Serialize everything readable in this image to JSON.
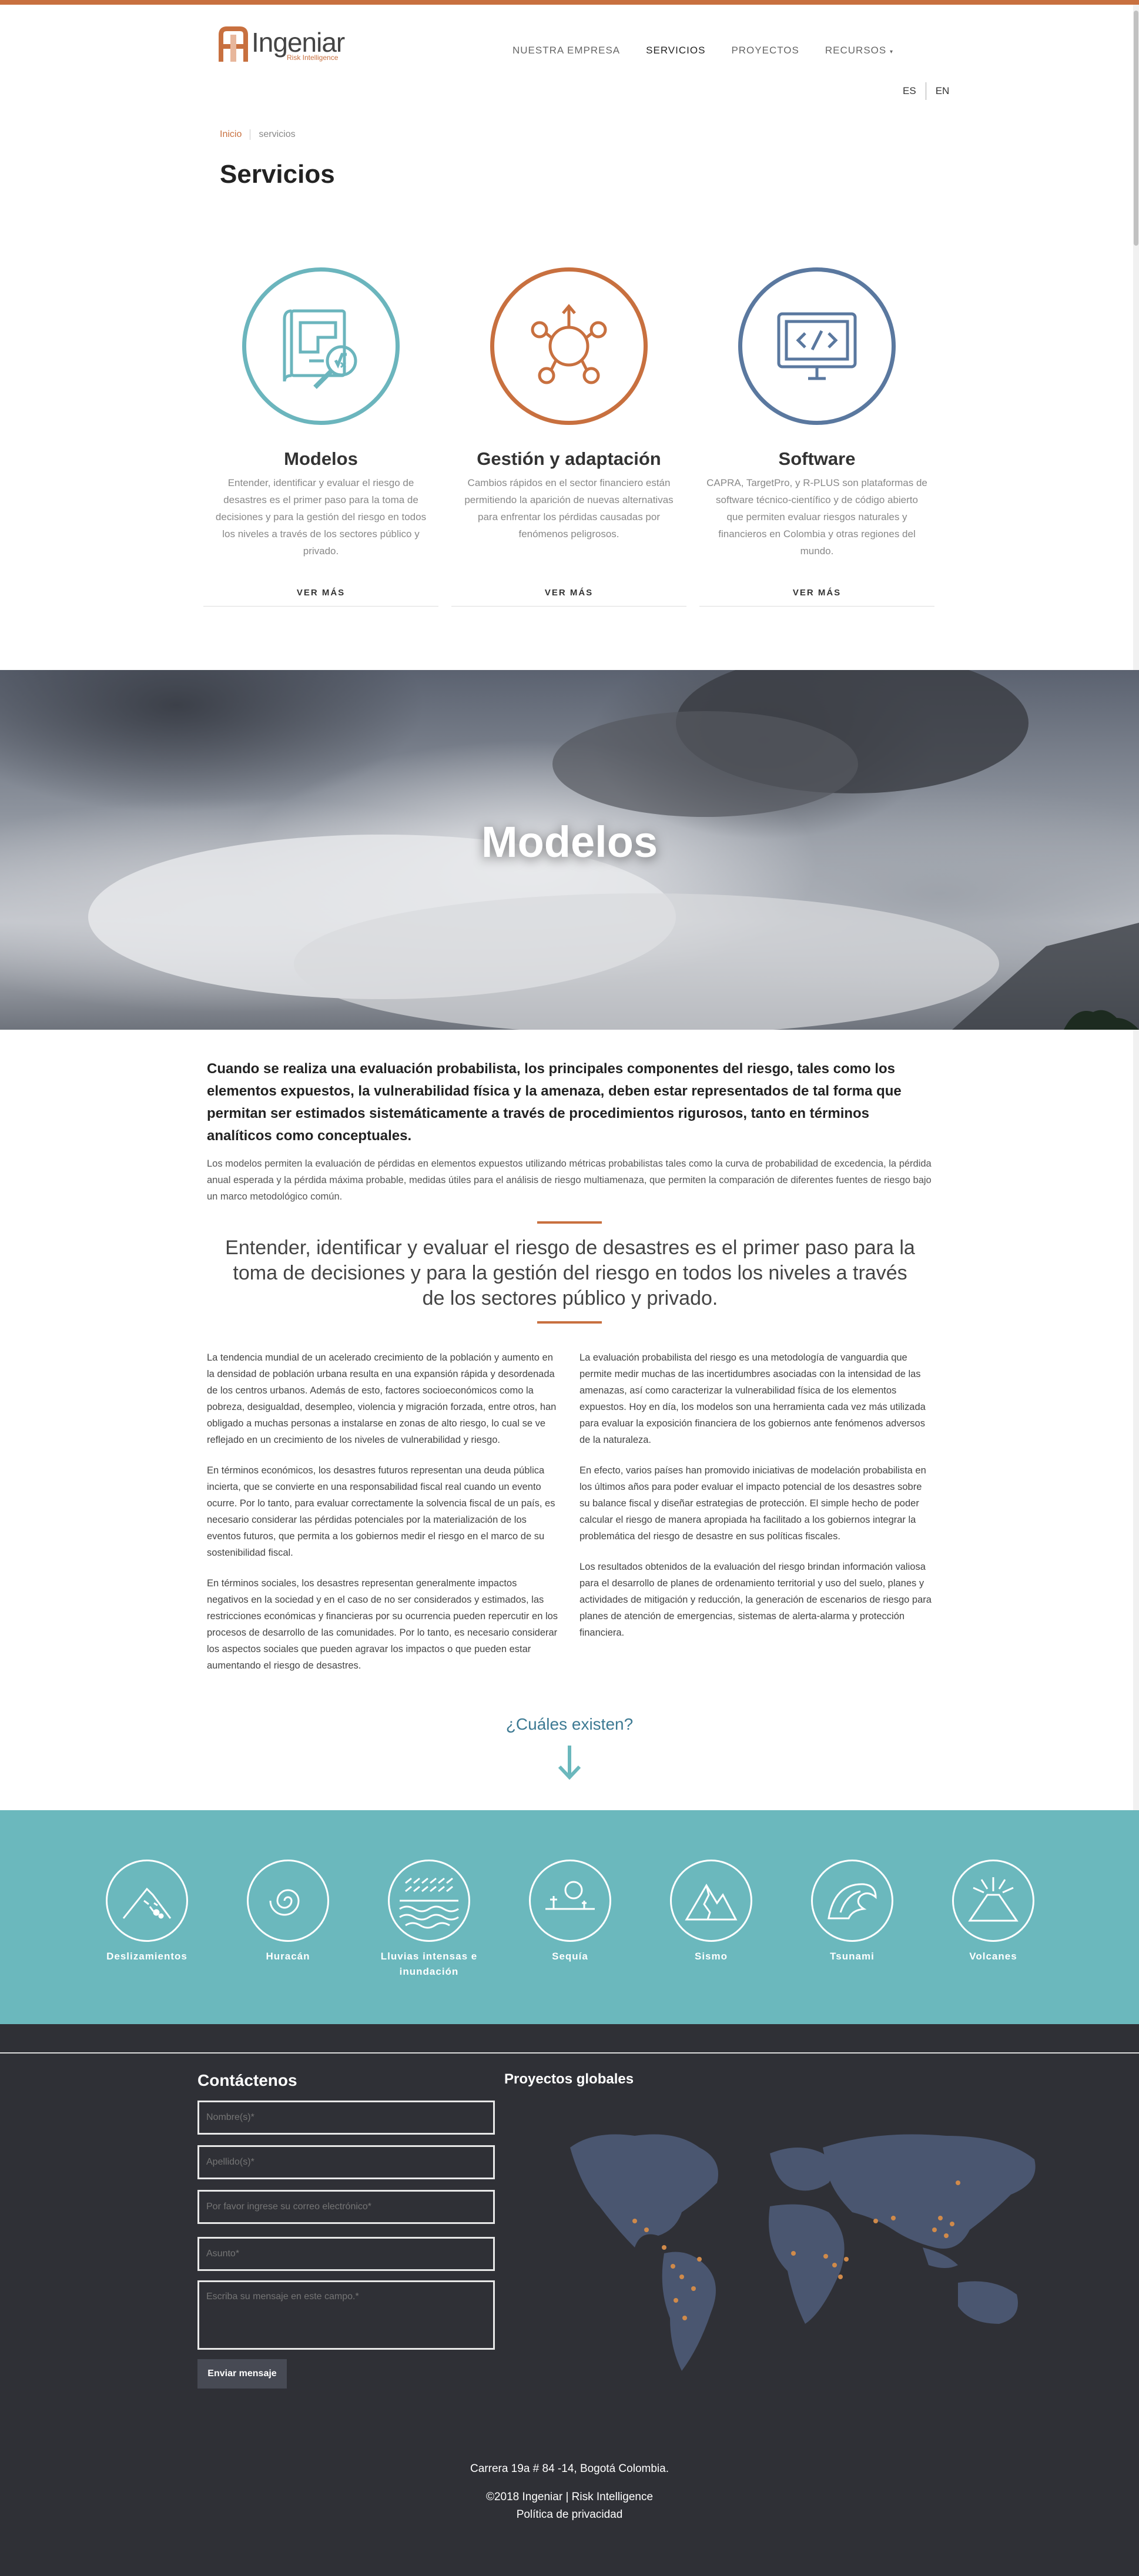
{
  "brand": {
    "name": "Ingeniar",
    "subtitle": "Risk Intelligence",
    "accent": "#c8703f"
  },
  "nav": {
    "items": [
      "NUESTRA EMPRESA",
      "SERVICIOS",
      "PROYECTOS",
      "RECURSOS"
    ],
    "active": "SERVICIOS"
  },
  "lang": {
    "es": "ES",
    "en": "EN"
  },
  "breadcrumb": {
    "home": "Inicio",
    "current": "servicios"
  },
  "page_title": "Servicios",
  "services": [
    {
      "title": "Modelos",
      "text": "Entender, identificar y evaluar el riesgo de desastres es el primer paso para la toma de decisiones y para la gestión del riesgo en todos los niveles a través de los sectores público y privado.",
      "more": "VER MÁS",
      "color": "#6bb5bd"
    },
    {
      "title": "Gestión y adaptación",
      "text": "Cambios rápidos en el sector financiero están permitiendo la aparición de nuevas alternativas para enfrentar los pérdidas causadas por fenómenos peligrosos.",
      "more": "VER MÁS",
      "color": "#c8703f"
    },
    {
      "title": "Software",
      "text": "CAPRA, TargetPro, y R-PLUS son plataformas de software técnico-científico y de código abierto que permiten evaluar riesgos naturales y financieros en Colombia y otras regiones del mundo.",
      "more": "VER MÁS",
      "color": "#5a789f"
    }
  ],
  "hero": {
    "title": "Modelos"
  },
  "lead": "Cuando se realiza una evaluación probabilista, los principales componentes del riesgo, tales como los elementos expuestos, la vulnerabilidad física y la amenaza, deben estar representados de tal forma que permitan ser estimados sistemáticamente a través de procedimientos rigurosos, tanto en términos analíticos como conceptuales.",
  "intro": "Los modelos permiten la evaluación de pérdidas en elementos expuestos utilizando métricas probabilistas tales como la curva de probabilidad de excedencia, la pérdida anual esperada y la pérdida máxima probable, medidas útiles para el análisis de riesgo multiamenaza, que permiten la comparación de diferentes fuentes de riesgo bajo un marco metodológico común.",
  "quote": "Entender, identificar y evaluar el riesgo de desastres es el primer paso para la toma de decisiones y para la gestión del riesgo en todos los niveles a través de los sectores público y privado.",
  "left_col": [
    "La tendencia mundial de un acelerado crecimiento de la población y aumento en la densidad de población urbana resulta en una expansión rápida y desordenada de los centros urbanos. Además de esto, factores socioeconómicos como la pobreza, desigualdad, desempleo, violencia y migración forzada, entre otros, han obligado a muchas personas a instalarse en zonas de alto riesgo, lo cual se ve reflejado en un crecimiento de los niveles de vulnerabilidad y riesgo.",
    "En términos económicos, los desastres futuros representan una deuda pública incierta, que se convierte en una responsabilidad fiscal real cuando un evento ocurre. Por lo tanto, para evaluar correctamente la solvencia fiscal de un país, es necesario considerar las pérdidas potenciales por la materialización de los eventos futuros, que permita a los gobiernos medir el riesgo en el marco de su sostenibilidad fiscal.",
    "En términos sociales, los desastres representan generalmente impactos negativos en la sociedad y en el caso de no ser considerados y estimados, las restricciones económicas y financieras por su ocurrencia pueden repercutir en los procesos de desarrollo de las comunidades. Por lo tanto, es necesario considerar los aspectos sociales que pueden agravar los impactos o que pueden estar aumentando el riesgo de desastres."
  ],
  "right_col": [
    "La evaluación probabilista del riesgo es una metodología de vanguardia que permite medir muchas de las incertidumbres asociadas con la intensidad de las amenazas, así como caracterizar la vulnerabilidad física de los elementos expuestos. Hoy en día, los modelos son una herramienta cada vez más utilizada para evaluar la exposición financiera de los gobiernos ante fenómenos adversos de la naturaleza.",
    "En efecto, varios países han promovido iniciativas de modelación probabilista en los últimos años para poder evaluar el impacto potencial de los desastres sobre su balance fiscal y diseñar estrategias de protección. El simple hecho de poder calcular el riesgo de manera apropiada ha facilitado a los gobiernos integrar la problemática del riesgo de desastre en sus políticas fiscales.",
    "Los resultados obtenidos de la evaluación del riesgo brindan información valiosa para el desarrollo de planes de ordenamiento territorial y uso del suelo, planes y actividades de mitigación y reducción, la generación de escenarios de riesgo para planes de atención de emergencias, sistemas de alerta-alarma y protección financiera."
  ],
  "exist_question": "¿Cuáles existen?",
  "hazards": [
    {
      "label": "Deslizamientos",
      "icon": "landslide-icon"
    },
    {
      "label": "Huracán",
      "icon": "hurricane-icon"
    },
    {
      "label": "Lluvias intensas e inundación",
      "icon": "flood-icon"
    },
    {
      "label": "Sequía",
      "icon": "drought-icon"
    },
    {
      "label": "Sismo",
      "icon": "earthquake-icon"
    },
    {
      "label": "Tsunami",
      "icon": "tsunami-icon"
    },
    {
      "label": "Volcanes",
      "icon": "volcano-icon"
    }
  ],
  "footer": {
    "contact_title": "Contáctenos",
    "projects_title": "Proyectos globales",
    "placeholders": {
      "name": "Nombre(s)*",
      "surname": "Apellido(s)*",
      "email": "Por favor ingrese su correo electrónico*",
      "subject": "Asunto*",
      "message": "Escriba su mensaje en este campo.*"
    },
    "send": "Enviar mensaje",
    "address": "Carrera 19a # 84 -14, Bogotá Colombia.",
    "copyright": "©2018 Ingeniar | Risk Intelligence",
    "privacy": "Política de privacidad"
  }
}
